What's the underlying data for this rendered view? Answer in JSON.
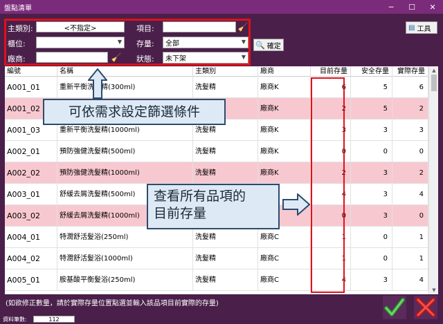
{
  "window": {
    "title": "盤點清單",
    "minimize": "─",
    "maximize": "☐",
    "close": "✕"
  },
  "filters": {
    "category_label": "主類別:",
    "category_value": "<不指定>",
    "item_label": "項目:",
    "item_value": "",
    "shelf_label": "櫃位:",
    "shelf_value": "",
    "stock_label": "存量:",
    "stock_value": "全部",
    "vendor_label": "廠商:",
    "vendor_value": "",
    "status_label": "狀態:",
    "status_value": "未下架",
    "confirm_label": "確定",
    "tools_label": "工具"
  },
  "table": {
    "headers": [
      "編號",
      "名稱",
      "主類別",
      "廠商",
      "目前存量",
      "安全存量",
      "實際存量"
    ],
    "rows": [
      {
        "id": "A001_01",
        "name": "重新平衡洗髮精(300ml)",
        "category": "洗髮精",
        "vendor": "廠商K",
        "current": "6",
        "safety": "5",
        "actual": "6",
        "pink": false
      },
      {
        "id": "A001_02",
        "name": "重新平衡洗髮精(500ml)",
        "category": "洗髮精",
        "vendor": "廠商K",
        "current": "2",
        "safety": "5",
        "actual": "2",
        "pink": true
      },
      {
        "id": "A001_03",
        "name": "重新平衡洗髮精(1000ml)",
        "category": "洗髮精",
        "vendor": "廠商K",
        "current": "3",
        "safety": "3",
        "actual": "3",
        "pink": false
      },
      {
        "id": "A002_01",
        "name": "預防強健洗髮精(500ml)",
        "category": "洗髮精",
        "vendor": "廠商K",
        "current": "0",
        "safety": "0",
        "actual": "0",
        "pink": false
      },
      {
        "id": "A002_02",
        "name": "預防強健洗髮精(1000ml)",
        "category": "洗髮精",
        "vendor": "廠商K",
        "current": "2",
        "safety": "3",
        "actual": "2",
        "pink": true
      },
      {
        "id": "A003_01",
        "name": "舒緩去屑洗髮精(500ml)",
        "category": "洗髮精",
        "vendor": "廠商K",
        "current": "4",
        "safety": "3",
        "actual": "4",
        "pink": false
      },
      {
        "id": "A003_02",
        "name": "舒緩去屑洗髮精(1000ml)",
        "category": "洗髮精",
        "vendor": "廠商K",
        "current": "0",
        "safety": "3",
        "actual": "0",
        "pink": true
      },
      {
        "id": "A004_01",
        "name": "特潤舒活髮浴(250ml)",
        "category": "洗髮精",
        "vendor": "廠商C",
        "current": "1",
        "safety": "0",
        "actual": "1",
        "pink": false
      },
      {
        "id": "A004_02",
        "name": "特潤舒活髮浴(1000ml)",
        "category": "洗髮精",
        "vendor": "廠商C",
        "current": "1",
        "safety": "0",
        "actual": "1",
        "pink": false
      },
      {
        "id": "A005_01",
        "name": "胺基酸平衡髮浴(250ml)",
        "category": "洗髮精",
        "vendor": "廠商C",
        "current": "4",
        "safety": "3",
        "actual": "4",
        "pink": false
      }
    ]
  },
  "callouts": {
    "filter_hint": "可依需求設定篩選條件",
    "stock_hint_line1": "查看所有品項的",
    "stock_hint_line2": "目前存量"
  },
  "footer": {
    "note": "(如欲修正數量，請於實際存量位置點選並輸入該品項目前實際的存量)",
    "record_label": "資料筆數:",
    "record_count": "112"
  },
  "colors": {
    "window_bg": "#4a1f4a",
    "titlebar": "#7a2b7a",
    "highlight_row": "#f8c8d0",
    "annotation_red": "#e0101a",
    "callout_bg": "#dde9f4"
  }
}
